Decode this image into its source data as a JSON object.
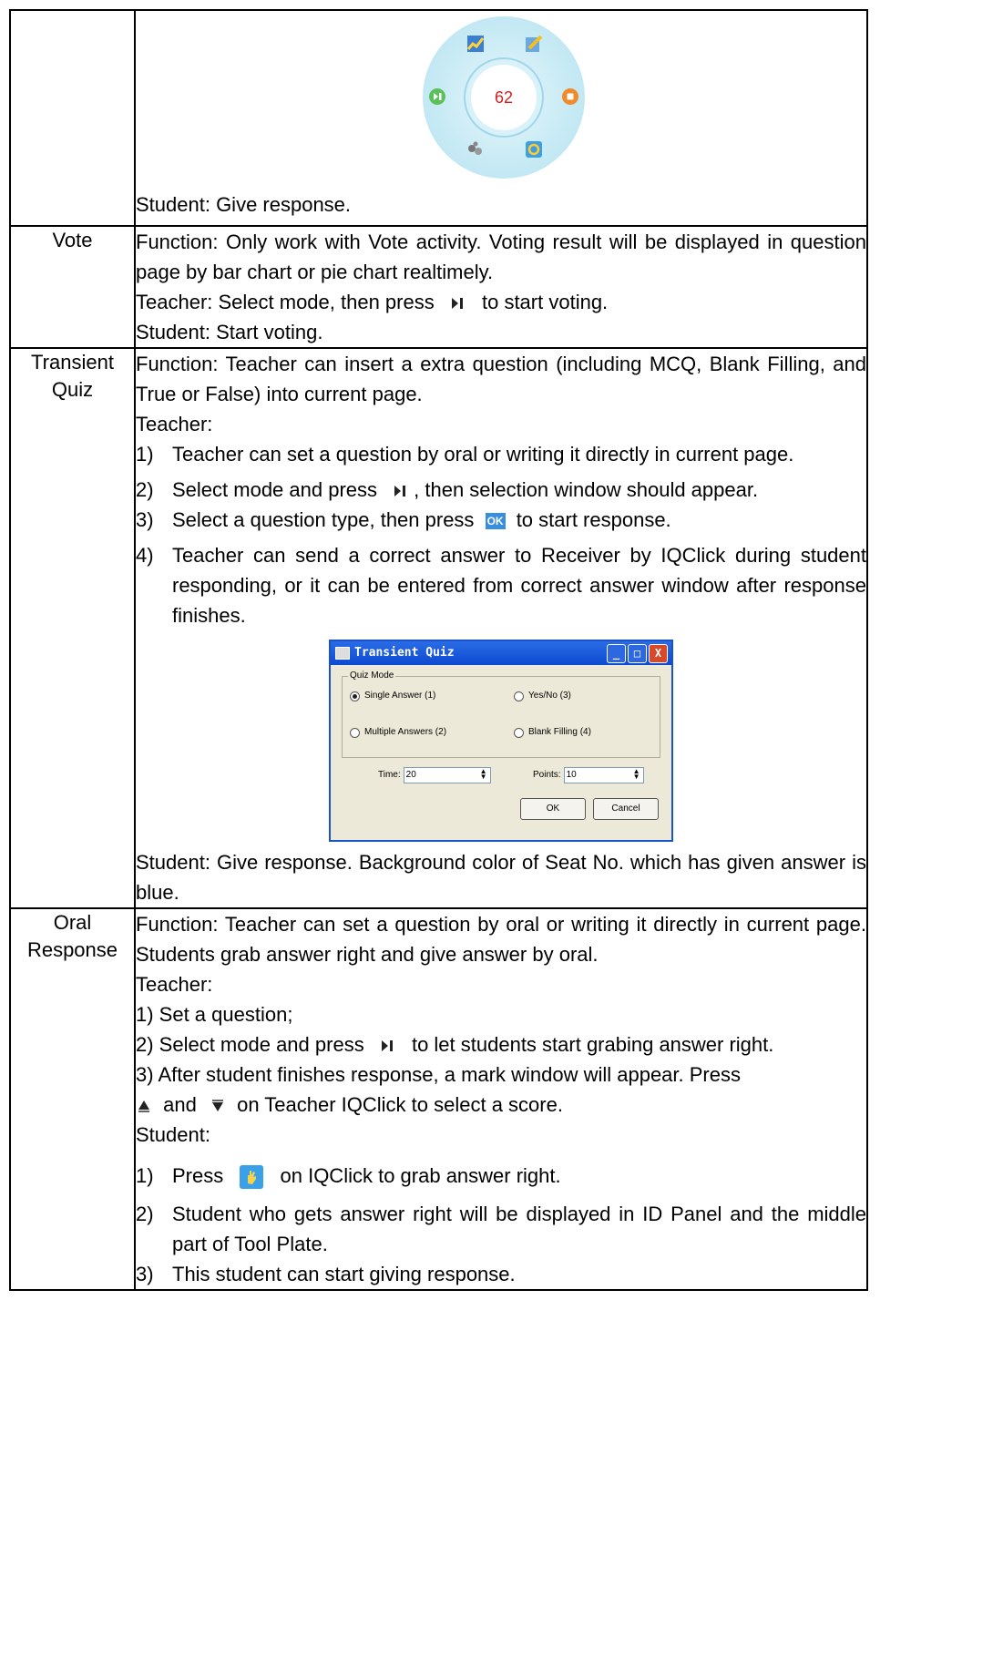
{
  "tool_plate": {
    "counter": "62"
  },
  "rows": [
    {
      "label": "",
      "content": {
        "student": "Student: Give response."
      }
    },
    {
      "label": "Vote",
      "content": {
        "function": "Function: Only work with Vote activity. Voting result will be displayed in question page by bar chart or pie chart realtimely.",
        "teacher_a": "Teacher:  Select mode, then press",
        "teacher_b": "to start voting.",
        "student": "Student: Start voting."
      }
    },
    {
      "label_line1": "Transient",
      "label_line2": "Quiz",
      "content": {
        "function": "Function: Teacher can insert a extra question (including MCQ, Blank Filling, and True or False) into current page.",
        "teacher": "Teacher:",
        "items": [
          {
            "n": "1)",
            "text": "Teacher can set a question by oral or writing it directly in current page."
          },
          {
            "n": "2)",
            "text_a": "Select mode and press",
            "text_b": ", then selection window should appear."
          },
          {
            "n": "3)",
            "text_a": "Select a question type, then press",
            "text_b": "to start response."
          },
          {
            "n": "4)",
            "text": "Teacher can send a correct answer to Receiver by IQClick during student responding, or it can be entered from correct answer window after response finishes."
          }
        ],
        "ok_icon_text": "OK",
        "student": "Student: Give response. Background color of Seat No. which has given answer is blue."
      }
    },
    {
      "label_line1": "Oral",
      "label_line2": "Response",
      "content": {
        "function": "Function: Teacher can set a question by oral or writing it directly in current page. Students grab answer right and give answer by oral.",
        "teacher": "Teacher:",
        "t1": "1) Set a question;",
        "t2_a": "2) Select mode and press",
        "t2_b": "to let students start grabing answer right.",
        "t3_a": "3) After student finishes response, a mark window will appear. Press",
        "t3_b": "and",
        "t3_c": "on Teacher IQClick to select a score.",
        "student": "Student:",
        "s_items": [
          {
            "n": "1)",
            "text_a": "Press",
            "text_b": "on IQClick to grab answer right."
          },
          {
            "n": "2)",
            "text": "Student who gets answer right will be displayed in ID Panel and the middle part of Tool Plate."
          },
          {
            "n": "3)",
            "text": "This student can start giving response."
          }
        ]
      }
    }
  ],
  "dialog": {
    "title": "Transient Quiz",
    "group_label": "Quiz Mode",
    "options": [
      "Single Answer (1)",
      "Yes/No (3)",
      "Multiple Answers (2)",
      "Blank Filling (4)"
    ],
    "selected": "Single Answer (1)",
    "time_label": "Time:",
    "time_value": "20",
    "points_label": "Points:",
    "points_value": "10",
    "ok": "OK",
    "cancel": "Cancel",
    "min": "_",
    "max": "□",
    "close": "X"
  }
}
